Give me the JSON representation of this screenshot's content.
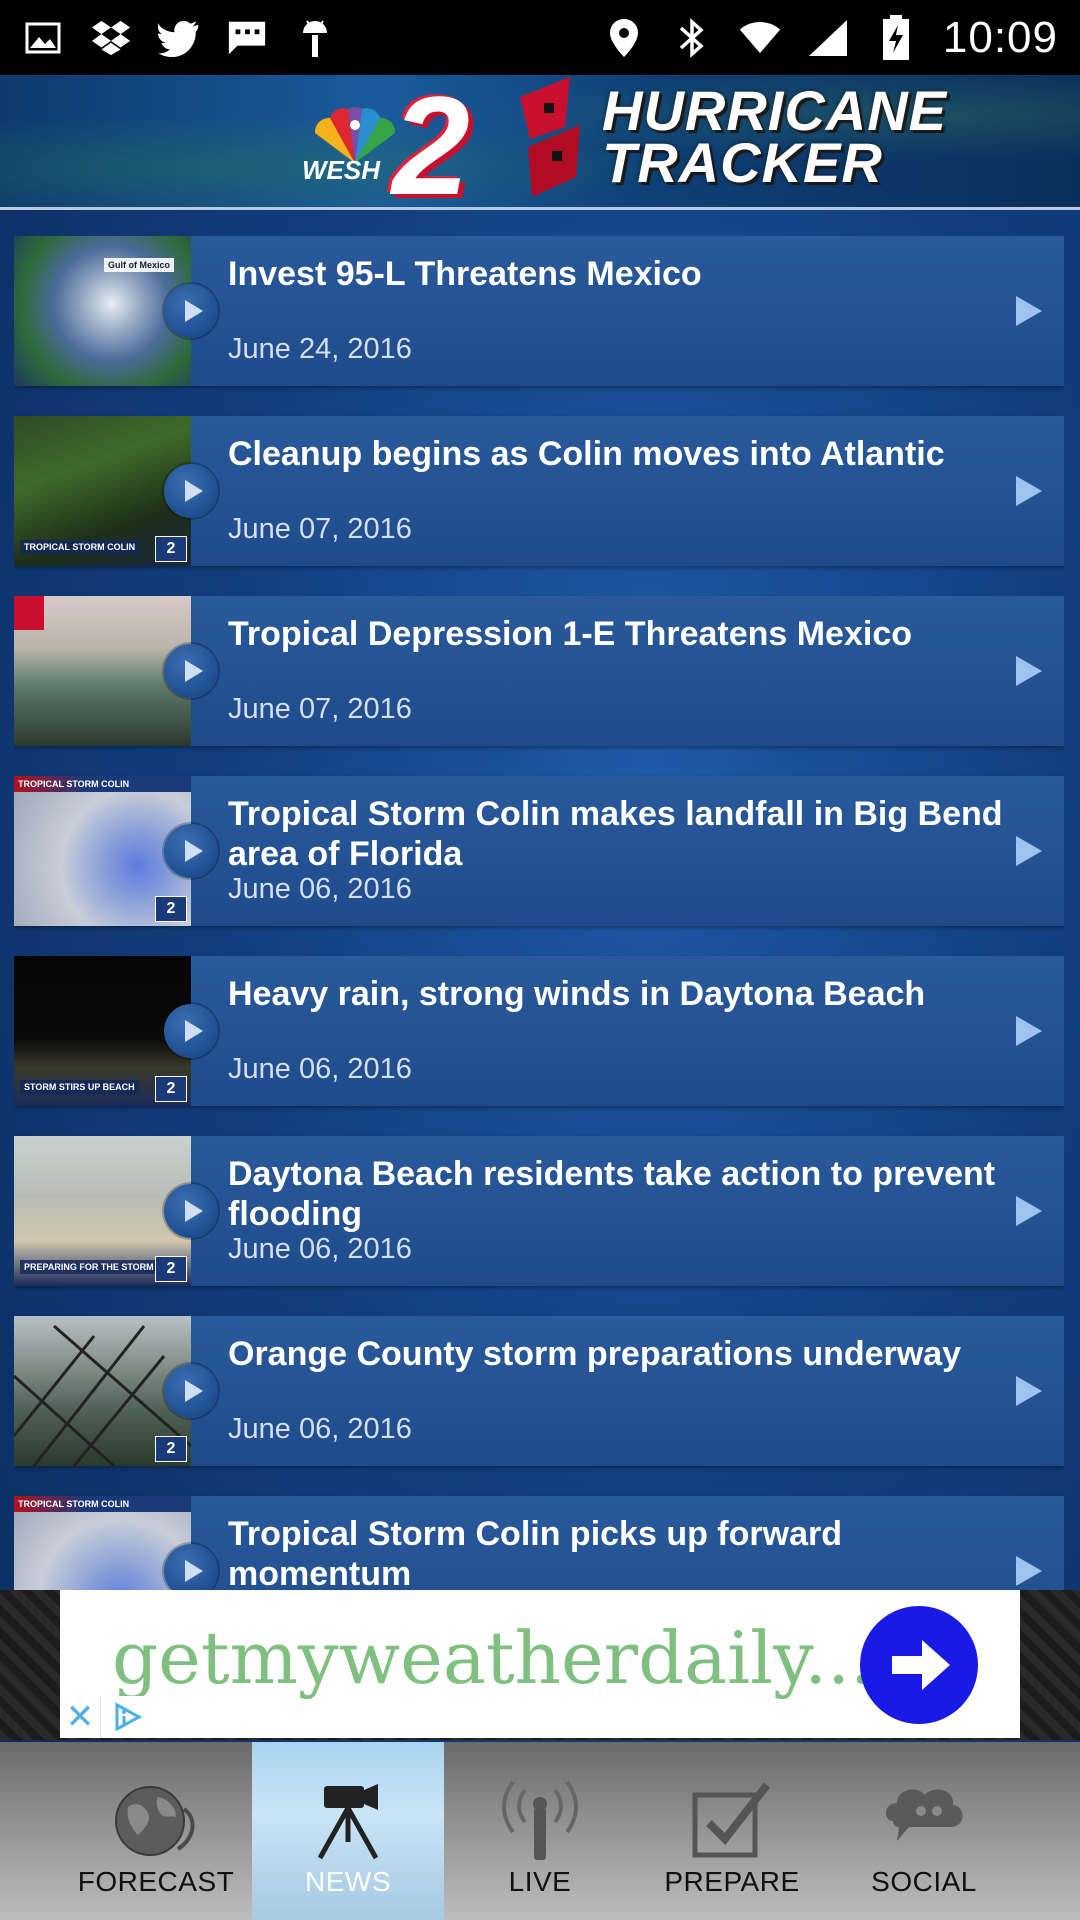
{
  "status_bar": {
    "time": "10:09",
    "left_icons": [
      "image-icon",
      "dropbox-icon",
      "twitter-icon",
      "message-icon",
      "android-icon"
    ],
    "right_icons": [
      "location-icon",
      "bluetooth-icon",
      "wifi-icon",
      "signal-icon",
      "battery-charging-icon"
    ]
  },
  "header": {
    "station": "WESH",
    "channel": "2",
    "title_line1": "HURRICANE",
    "title_line2": "TRACKER"
  },
  "news": {
    "items": [
      {
        "title": "Invest 95-L Threatens Mexico",
        "date": "June 24, 2016",
        "thumb_top": "",
        "thumb_label": "Gulf of Mexico"
      },
      {
        "title": "Cleanup begins as Colin moves into Atlantic",
        "date": "June 07, 2016",
        "thumb_top": "",
        "thumb_label": "TROPICAL STORM COLIN"
      },
      {
        "title": "Tropical Depression 1-E Threatens Mexico",
        "date": "June 07, 2016",
        "thumb_top": "",
        "thumb_label": ""
      },
      {
        "title": "Tropical Storm Colin makes landfall in Big Bend area of Florida",
        "date": "June 06, 2016",
        "thumb_top": "TROPICAL STORM COLIN",
        "thumb_label": ""
      },
      {
        "title": "Heavy rain, strong winds in Daytona Beach",
        "date": "June 06, 2016",
        "thumb_top": "",
        "thumb_label": "STORM STIRS UP BEACH"
      },
      {
        "title": "Daytona Beach residents take action to prevent flooding",
        "date": "June 06, 2016",
        "thumb_top": "",
        "thumb_label": "PREPARING FOR THE STORM"
      },
      {
        "title": "Orange County storm preparations underway",
        "date": "June 06, 2016",
        "thumb_top": "",
        "thumb_label": ""
      },
      {
        "title": "Tropical Storm Colin picks up forward momentum",
        "date": "",
        "thumb_top": "TROPICAL STORM COLIN",
        "thumb_label": ""
      }
    ]
  },
  "ad": {
    "text": "getmyweatherdaily...",
    "close_glyph": "✕"
  },
  "tabs": [
    {
      "label": "FORECAST",
      "icon": "globe-icon",
      "active": false
    },
    {
      "label": "NEWS",
      "icon": "camera-icon",
      "active": true
    },
    {
      "label": "LIVE",
      "icon": "antenna-icon",
      "active": false
    },
    {
      "label": "PREPARE",
      "icon": "checklist-icon",
      "active": false
    },
    {
      "label": "SOCIAL",
      "icon": "chat-cloud-icon",
      "active": false
    }
  ],
  "colors": {
    "accent_blue": "#1f4b8c",
    "active_tab": "#a8d3f0",
    "ad_text_green": "#7fbf7f",
    "ad_button": "#1a1ae6"
  }
}
